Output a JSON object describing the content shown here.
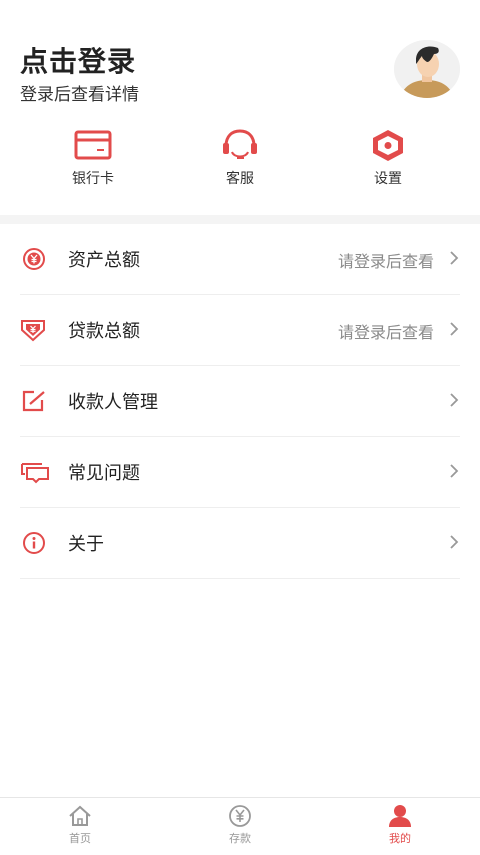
{
  "header": {
    "title": "点击登录",
    "subtitle": "登录后查看详情"
  },
  "quick_actions": [
    {
      "label": "银行卡",
      "icon": "bank-card-icon"
    },
    {
      "label": "客服",
      "icon": "headset-icon"
    },
    {
      "label": "设置",
      "icon": "settings-hexagon-icon"
    }
  ],
  "menu": [
    {
      "label": "资产总额",
      "value": "请登录后查看",
      "icon": "yuan-circle-icon"
    },
    {
      "label": "贷款总额",
      "value": "请登录后查看",
      "icon": "loan-shield-icon"
    },
    {
      "label": "收款人管理",
      "value": "",
      "icon": "edit-square-icon"
    },
    {
      "label": "常见问题",
      "value": "",
      "icon": "chat-bubble-icon"
    },
    {
      "label": "关于",
      "value": "",
      "icon": "info-circle-icon"
    }
  ],
  "tabbar": [
    {
      "label": "首页",
      "icon": "home-icon",
      "active": false
    },
    {
      "label": "存款",
      "icon": "yuan-icon",
      "active": false
    },
    {
      "label": "我的",
      "icon": "user-icon",
      "active": true
    }
  ],
  "colors": {
    "accent": "#e24b4b",
    "inactive": "#999999",
    "separator": "#f4f4f4"
  }
}
